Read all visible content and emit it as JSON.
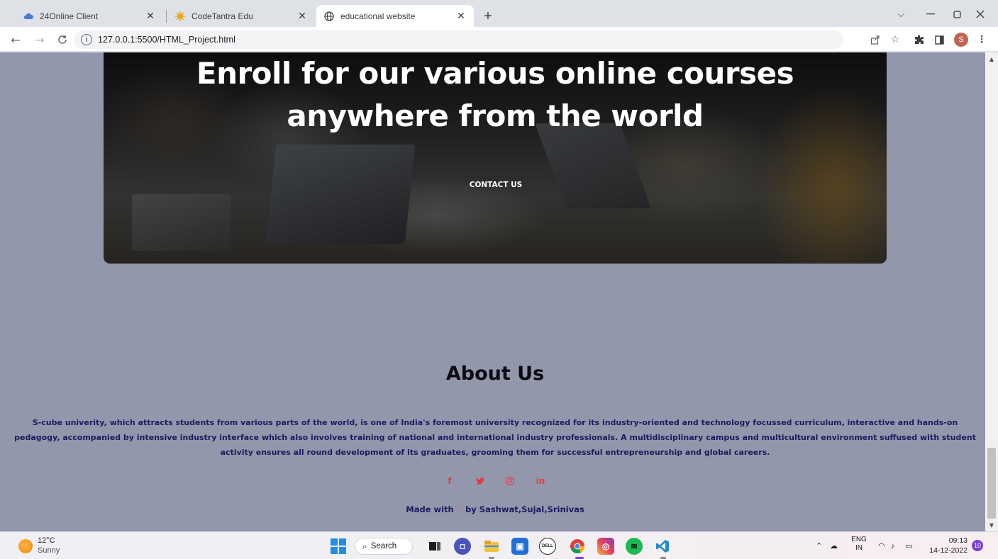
{
  "browser": {
    "tabs": [
      {
        "label": "24Online Client",
        "icon": "cloud-icon",
        "active": false
      },
      {
        "label": "CodeTantra Edu",
        "icon": "codetantra-icon",
        "active": false
      },
      {
        "label": "educational website",
        "icon": "globe-icon",
        "active": true
      }
    ],
    "new_tab": "+",
    "address": "127.0.0.1:5500/HTML_Project.html",
    "profile_initial": "S"
  },
  "page": {
    "hero": {
      "title": "Enroll for our various online courses anywhere from the world",
      "cta": "CONTACT US"
    },
    "about": {
      "title": "About Us",
      "text": "S-cube univerity, which attracts students from various parts of the world, is one of India's foremost university recognized for its industry-oriented and technology focussed curriculum, interactive and hands-on pedagogy, accompanied by intensive industry interface which also involves training of national and international industry professionals. A multidisciplinary campus and multicultural environment suffused with student activity ensures all round development of its graduates, grooming them for successful entrepreneurship and global careers."
    },
    "socials": [
      {
        "name": "facebook",
        "glyph": "f"
      },
      {
        "name": "twitter",
        "glyph": "❧"
      },
      {
        "name": "instagram",
        "glyph": "◎"
      },
      {
        "name": "linkedin",
        "glyph": "in"
      }
    ],
    "footer": {
      "made_with": "Made with",
      "heart": "♡",
      "by": "by Sashwat,Sujal,Srinivas"
    }
  },
  "taskbar": {
    "weather": {
      "temp": "12°C",
      "condition": "Sunny"
    },
    "search_label": "Search",
    "lang_top": "ENG",
    "lang_bottom": "IN",
    "time": "09:13",
    "date": "14-12-2022",
    "notifications": "10"
  },
  "colors": {
    "page_bg": "#9397ac",
    "text_navy": "#1c1a5e",
    "social_red": "#e23d3d",
    "heart_pink": "#e84a6a"
  }
}
